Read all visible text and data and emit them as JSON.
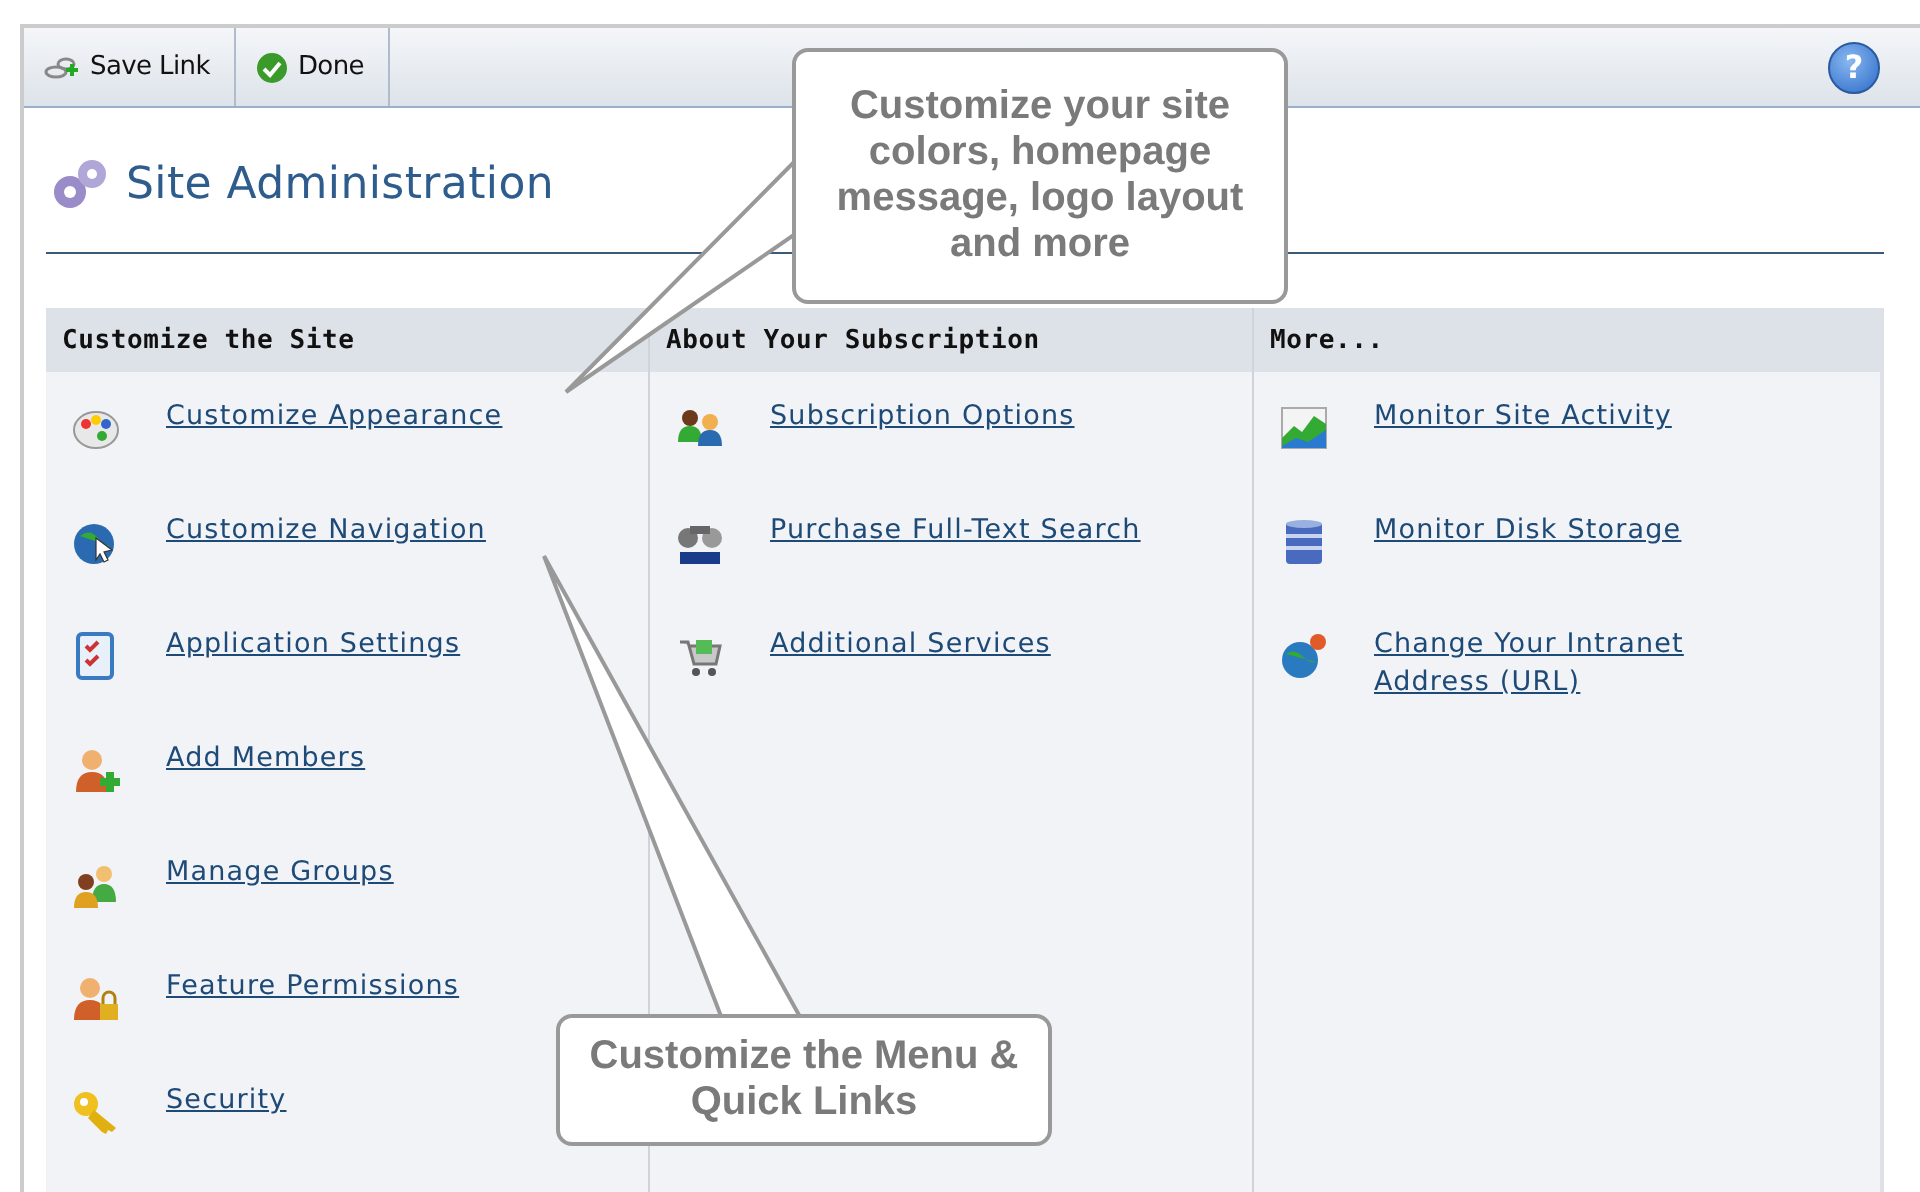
{
  "toolbar": {
    "buttons": [
      {
        "label": "Save Link"
      },
      {
        "label": "Done"
      }
    ],
    "help_button": {
      "label": "?"
    }
  },
  "title": "Site Administration",
  "columns": [
    {
      "heading": "Customize the Site",
      "links": [
        "Customize Appearance",
        "Customize Navigation",
        "Application Settings",
        "Add Members",
        "Manage Groups",
        "Feature Permissions",
        "Security"
      ]
    },
    {
      "heading": "About Your Subscription",
      "links": [
        "Subscription Options",
        "Purchase Full-Text Search",
        "Additional Services"
      ]
    },
    {
      "heading": "More...",
      "links": [
        "Monitor Site Activity",
        "Monitor Disk Storage",
        "Change Your Intranet Address (URL)"
      ]
    }
  ],
  "callouts": [
    {
      "text": "Customize your site colors, homepage message, logo layout and more"
    },
    {
      "text": "Customize the Menu & Quick Links"
    }
  ]
}
